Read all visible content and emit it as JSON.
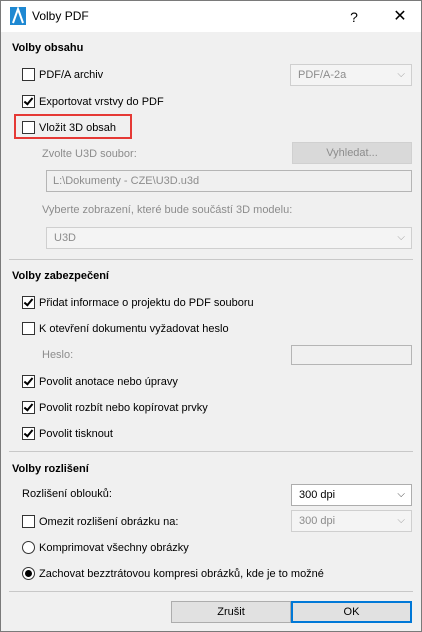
{
  "window": {
    "title": "Volby PDF",
    "help_label": "?",
    "close_label": "✕",
    "icon": "archicad-icon"
  },
  "content_section": {
    "title": "Volby obsahu",
    "pdfa": {
      "label": "PDF/A archiv",
      "checked": false,
      "select_value": "PDF/A-2a"
    },
    "export_layers": {
      "label": "Exportovat vrstvy do PDF",
      "checked": true
    },
    "insert_3d": {
      "label": "Vložit 3D obsah",
      "checked": false
    },
    "u3d_file_label": "Zvolte U3D soubor:",
    "browse_label": "Vyhledat...",
    "u3d_path": "L:\\Dokumenty - CZE\\U3D.u3d",
    "view_label": "Vyberte zobrazení, které bude součástí 3D modelu:",
    "view_select_value": "U3D"
  },
  "security_section": {
    "title": "Volby zabezpečení",
    "add_project_info": {
      "label": "Přidat informace o projektu do PDF souboru",
      "checked": true
    },
    "require_password": {
      "label": "K otevření dokumentu vyžadovat heslo",
      "checked": false
    },
    "password_label": "Heslo:",
    "allow_annotations": {
      "label": "Povolit anotace nebo úpravy",
      "checked": true
    },
    "allow_extract": {
      "label": "Povolit rozbít nebo kopírovat prvky",
      "checked": true
    },
    "allow_print": {
      "label": "Povolit tisknout",
      "checked": true
    }
  },
  "resolution_section": {
    "title": "Volby rozlišení",
    "arc_resolution_label": "Rozlišení oblouků:",
    "arc_resolution_value": "300 dpi",
    "limit_image": {
      "label": "Omezit rozlišení obrázku na:",
      "checked": false,
      "value": "300 dpi"
    },
    "compress_all": {
      "label": "Komprimovat všechny obrázky",
      "selected": false
    },
    "keep_lossless": {
      "label": "Zachovat bezztrátovou kompresi obrázků, kde je to možné",
      "selected": true
    }
  },
  "footer": {
    "cancel_label": "Zrušit",
    "ok_label": "OK"
  },
  "colors": {
    "highlight": "#e53935",
    "primary_border": "#0078d7"
  }
}
